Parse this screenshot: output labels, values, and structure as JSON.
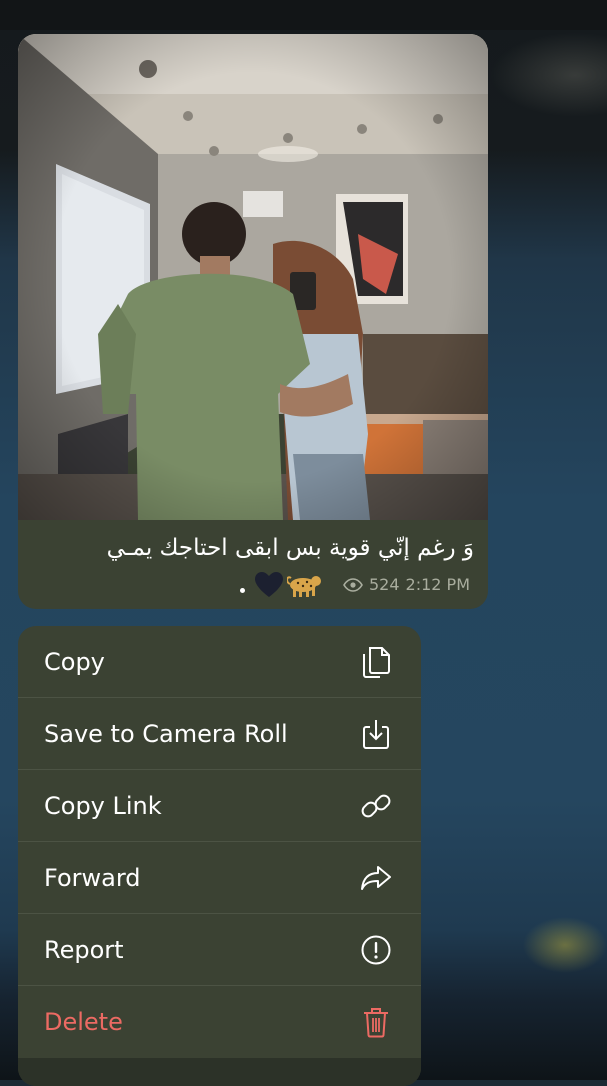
{
  "message": {
    "caption": "وَ رغم إنّي قوية بس ابقى احتاجك يمـي",
    "emojis": [
      "•",
      "🖤",
      "🐆"
    ],
    "views": "524",
    "time": "2:12 PM",
    "views_icon": "eye-icon"
  },
  "menu": {
    "items": [
      {
        "label": "Copy",
        "icon": "copy-icon"
      },
      {
        "label": "Save to Camera Roll",
        "icon": "save-download-icon"
      },
      {
        "label": "Copy Link",
        "icon": "link-icon"
      },
      {
        "label": "Forward",
        "icon": "forward-arrow-icon"
      },
      {
        "label": "Report",
        "icon": "report-exclamation-icon"
      },
      {
        "label": "Delete",
        "icon": "trash-icon"
      }
    ]
  },
  "colors": {
    "bubble": "#3b4233",
    "menu": "#3b4233",
    "delete": "#ec6a63",
    "meta_text": "#a9ad9e"
  }
}
